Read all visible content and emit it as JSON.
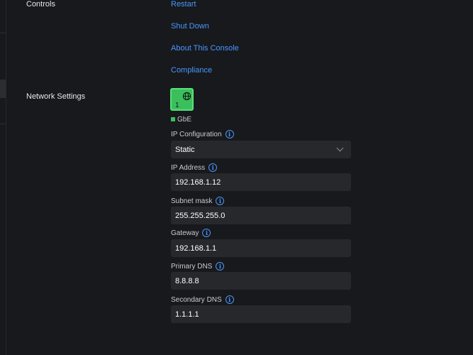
{
  "controls": {
    "label": "Controls",
    "actions": [
      {
        "label": "Restart"
      },
      {
        "label": "Shut Down"
      },
      {
        "label": "About This Console"
      },
      {
        "label": "Compliance"
      }
    ]
  },
  "network": {
    "label": "Network Settings",
    "port": {
      "number": "1",
      "status_color": "#3bbf5c",
      "icon": "globe-icon"
    },
    "legend": {
      "label": "GbE",
      "color": "#3bbf5c"
    },
    "ip_configuration": {
      "label": "IP Configuration",
      "value": "Static"
    },
    "ip_address": {
      "label": "IP Address",
      "value": "192.168.1.12"
    },
    "subnet_mask": {
      "label": "Subnet mask",
      "value": "255.255.255.0"
    },
    "gateway": {
      "label": "Gateway",
      "value": "192.168.1.1"
    },
    "primary_dns": {
      "label": "Primary DNS",
      "value": "8.8.8.8"
    },
    "secondary_dns": {
      "label": "Secondary DNS",
      "value": "1.1.1.1"
    }
  },
  "colors": {
    "accent": "#4797ff",
    "background": "#18191c",
    "field": "#26282b"
  }
}
